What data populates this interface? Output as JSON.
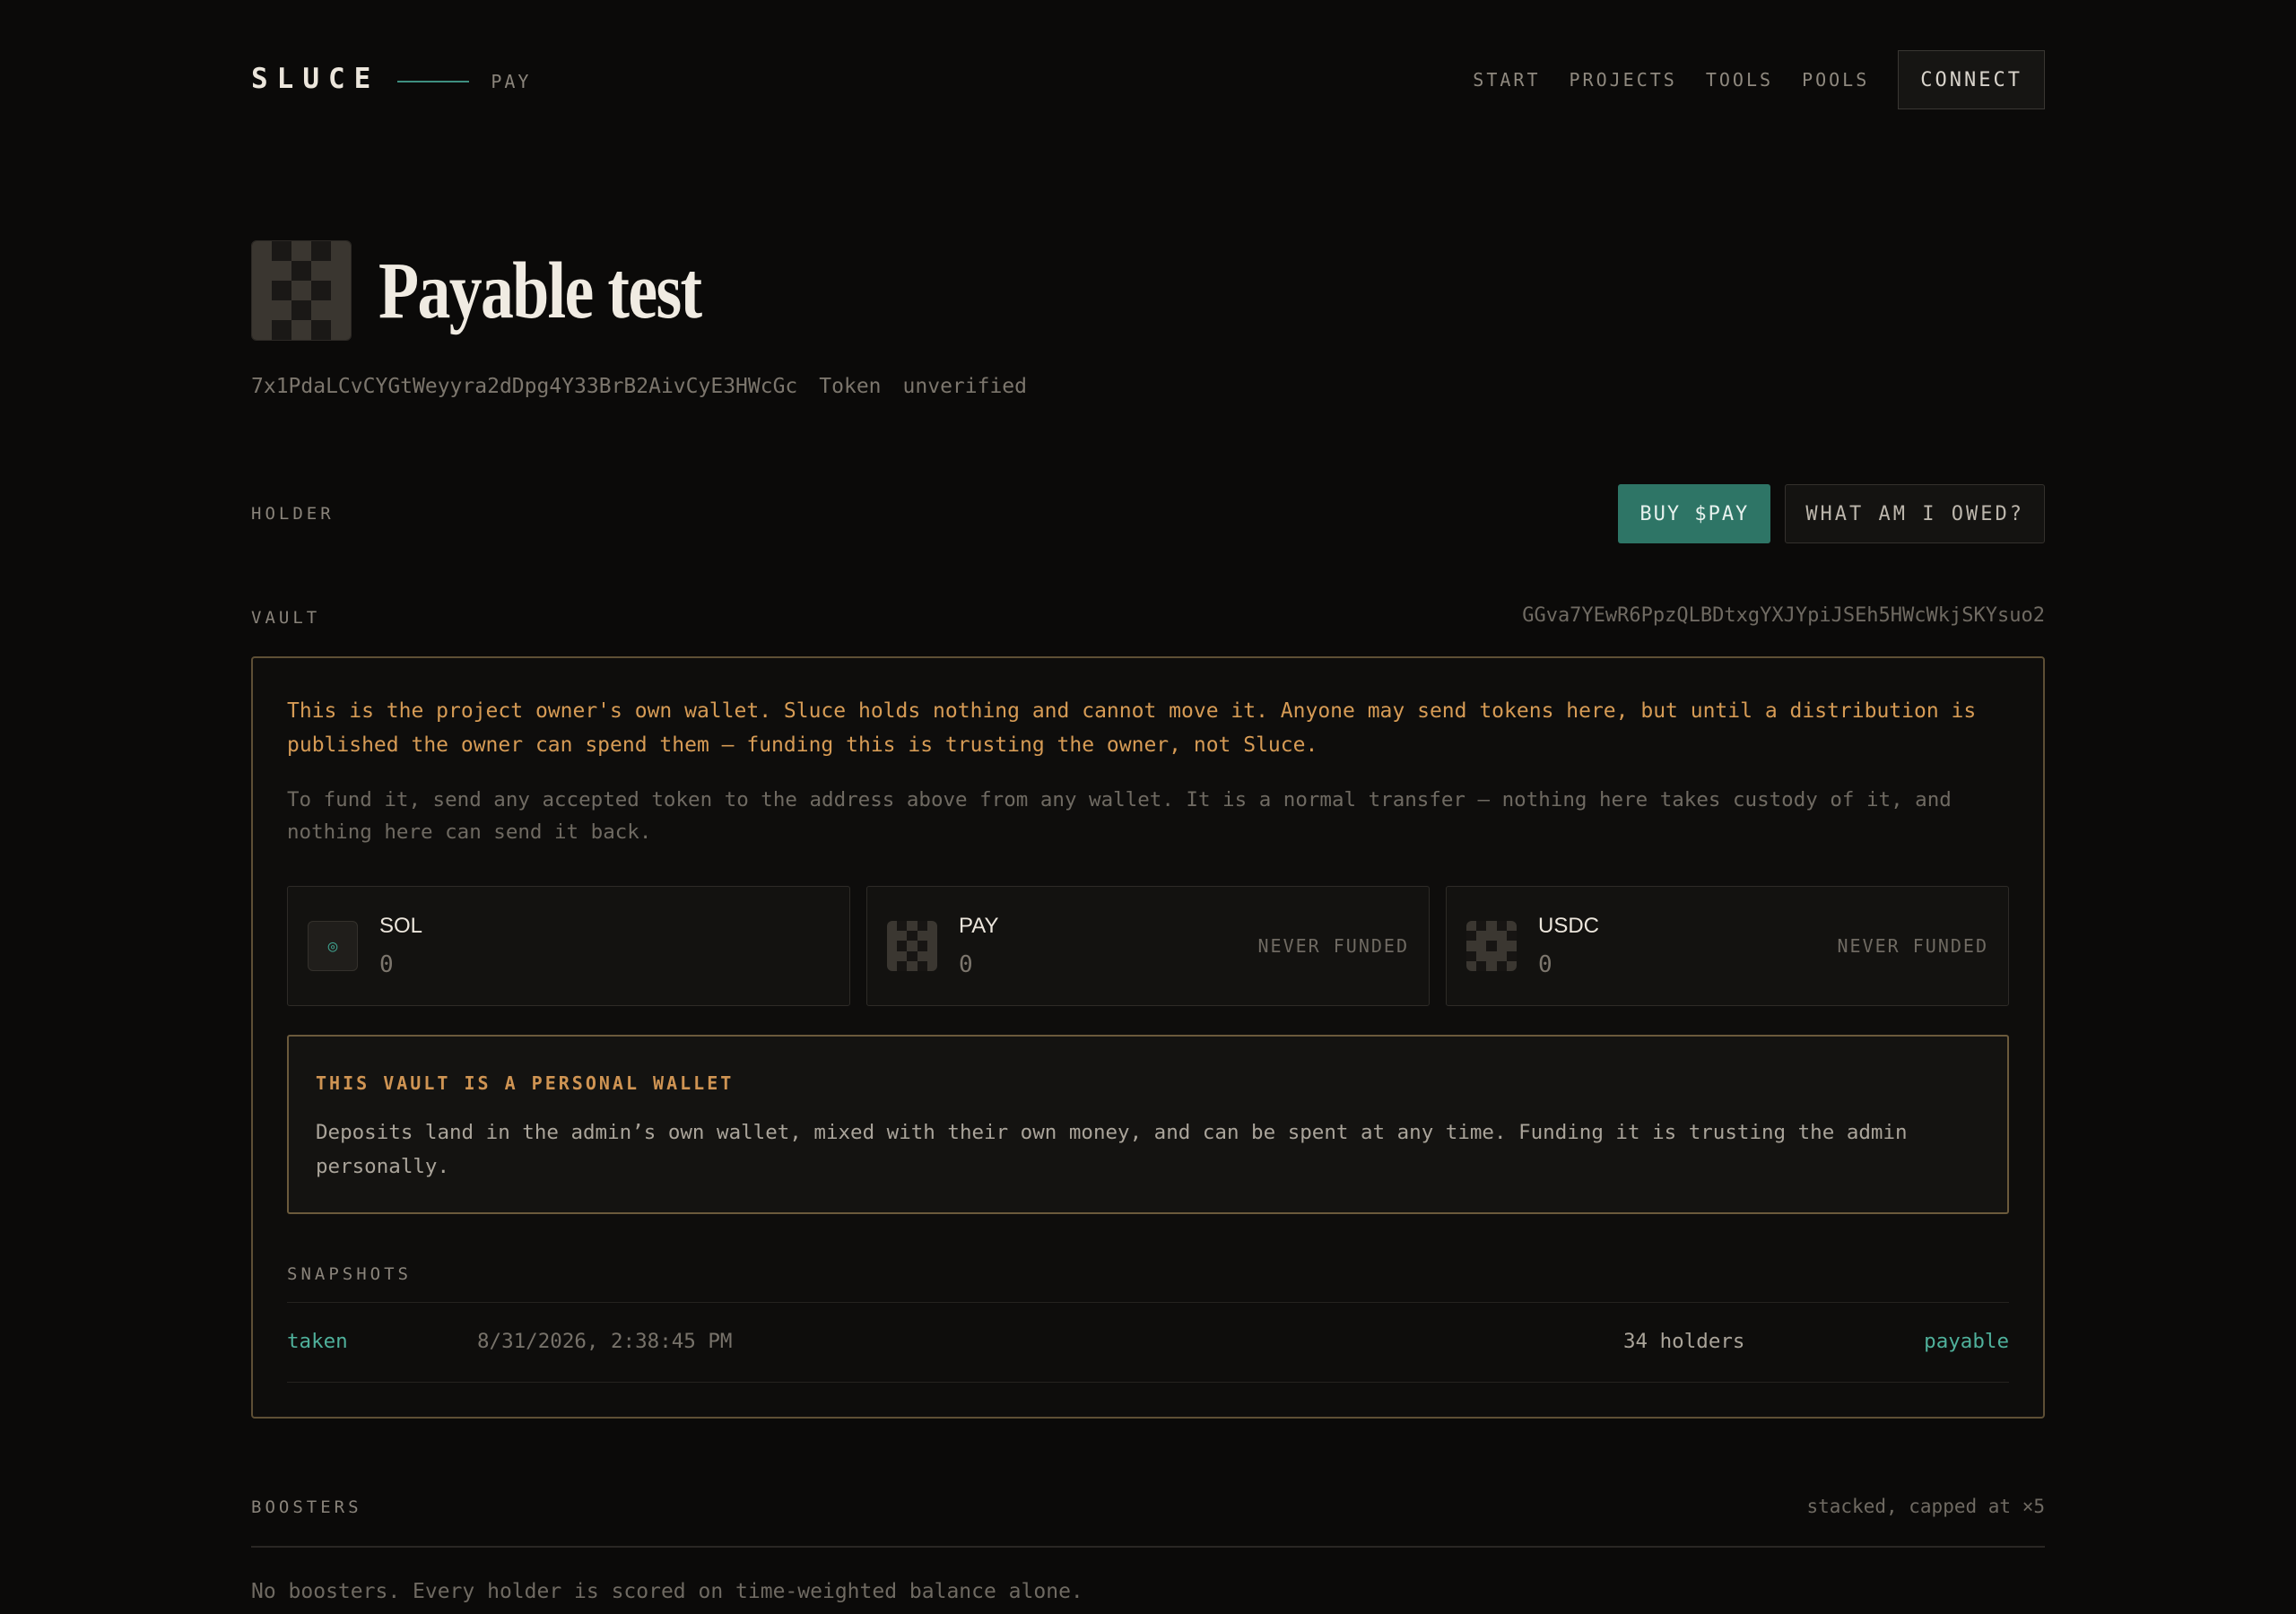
{
  "header": {
    "brand": "SLUCE",
    "brand_sub": "PAY",
    "nav": [
      "START",
      "PROJECTS",
      "TOOLS",
      "POOLS"
    ],
    "connect_label": "CONNECT"
  },
  "project": {
    "title": "Payable test",
    "address": "7x1PdaLCvCYGtWeyyra2dDpg4Y33BrB2AivCyE3HWcGc",
    "kind": "Token",
    "verification": "unverified"
  },
  "holder": {
    "label": "HOLDER",
    "buy_label": "BUY $PAY",
    "owed_label": "WHAT AM I OWED?"
  },
  "vault": {
    "label": "VAULT",
    "address": "GGva7YEwR6PpzQLBDtxgYXJYpiJSEh5HWcWkjSKYsuo2",
    "warning": "This is the project owner's own wallet. Sluce holds nothing and cannot move it. Anyone may send tokens here, but until a distribution is published the owner can spend them — funding this is trusting the owner, not Sluce.",
    "info": "To fund it, send any accepted token to the address above from any wallet. It is a normal transfer — nothing here takes custody of it, and nothing here can send it back.",
    "tokens": [
      {
        "name": "SOL",
        "balance": "0",
        "status": ""
      },
      {
        "name": "PAY",
        "balance": "0",
        "status": "NEVER FUNDED"
      },
      {
        "name": "USDC",
        "balance": "0",
        "status": "NEVER FUNDED"
      }
    ],
    "notice_title": "THIS VAULT IS A PERSONAL WALLET",
    "notice_body": "Deposits land in the admin’s own wallet, mixed with their own money, and can be spent at any time. Funding it is trusting the admin personally.",
    "snapshots_label": "SNAPSHOTS",
    "snapshots": [
      {
        "status": "taken",
        "date": "8/31/2026, 2:38:45 PM",
        "holders": "34 holders",
        "kind": "payable"
      }
    ]
  },
  "boosters": {
    "label": "BOOSTERS",
    "note": "stacked, capped at ×5",
    "empty": "No boosters. Every holder is scored on time-weighted balance alone."
  },
  "colors": {
    "accent": "#2e7566",
    "accent_text": "#4fb09b",
    "warning": "#d69b55",
    "background": "#0b0a09"
  }
}
